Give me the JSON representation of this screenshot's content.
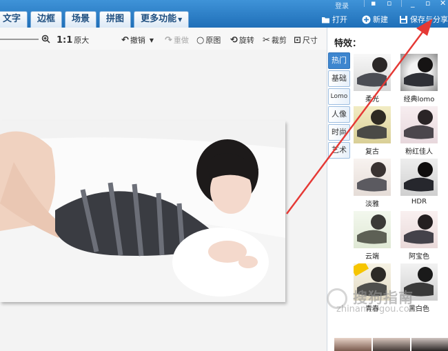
{
  "topbar": {
    "tabs": [
      "文字",
      "边框",
      "场景",
      "拼图",
      "更多功能"
    ],
    "login": "登录",
    "open_label": "打开",
    "new_label": "新建",
    "save_share_label": "保存与分享"
  },
  "toolbar": {
    "original_size": "1:1",
    "original_size_label": "原大",
    "undo": "撤销",
    "redo": "重做",
    "original_image": "原图",
    "rotate": "旋转",
    "crop": "裁剪",
    "size": "尺寸"
  },
  "panel": {
    "title": "特效：",
    "categories": [
      "热门",
      "基础",
      "Lomo",
      "人像",
      "时尚",
      "艺术"
    ],
    "active_category": "热门",
    "effects": [
      "柔光",
      "经典lomo",
      "复古",
      "粉红佳人",
      "淡雅",
      "HDR",
      "云端",
      "阿宝色",
      "青春",
      "黑白色"
    ]
  },
  "watermark": {
    "text": "zhinan.sogou.com"
  },
  "colors": {
    "title_bar": "#2a7cc7",
    "active_tab": "#3e86cf",
    "annotation_arrow": "#e53935"
  }
}
